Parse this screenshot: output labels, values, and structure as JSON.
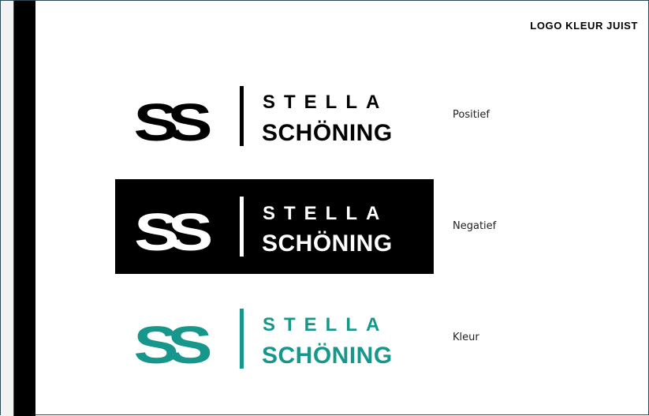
{
  "page": {
    "heading": "LOGO KLEUR JUIST"
  },
  "brand": {
    "monogram": "SS",
    "name_line1": "STELLA",
    "name_line2": "SCHÖNING"
  },
  "variants": [
    {
      "label": "Positief",
      "background": "#ffffff",
      "foreground": "#000000"
    },
    {
      "label": "Negatief",
      "background": "#000000",
      "foreground": "#ffffff"
    },
    {
      "label": "Kleur",
      "background": "#ffffff",
      "foreground": "#17968b"
    }
  ],
  "colors": {
    "accent_teal": "#17968b",
    "frame_border": "#2b4a56"
  }
}
